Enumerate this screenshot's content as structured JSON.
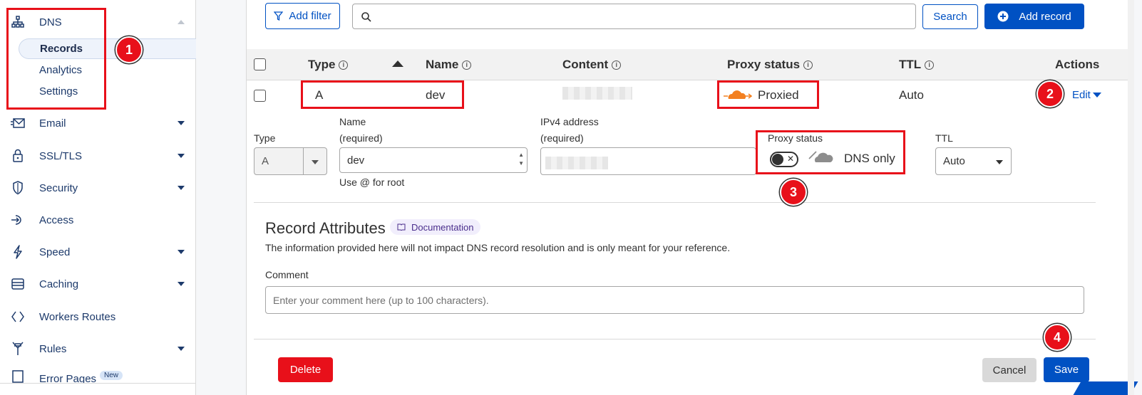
{
  "sidebar": {
    "dns": {
      "label": "DNS",
      "icon": "sitemap-icon"
    },
    "dns_sub": [
      {
        "label": "Records",
        "active": true
      },
      {
        "label": "Analytics",
        "active": false
      },
      {
        "label": "Settings",
        "active": false
      }
    ],
    "items": [
      {
        "label": "Email",
        "icon": "email-icon",
        "has_caret": true
      },
      {
        "label": "SSL/TLS",
        "icon": "lock-icon",
        "has_caret": true
      },
      {
        "label": "Security",
        "icon": "shield-icon",
        "has_caret": true
      },
      {
        "label": "Access",
        "icon": "access-icon",
        "has_caret": false
      },
      {
        "label": "Speed",
        "icon": "bolt-icon",
        "has_caret": true
      },
      {
        "label": "Caching",
        "icon": "database-icon",
        "has_caret": true
      },
      {
        "label": "Workers Routes",
        "icon": "workers-icon",
        "has_caret": false
      },
      {
        "label": "Rules",
        "icon": "rules-icon",
        "has_caret": true
      },
      {
        "label": "Error Pages",
        "icon": "error-pages-icon",
        "badge": "New"
      }
    ]
  },
  "toolbar": {
    "add_filter": "Add filter",
    "search_value": "",
    "search_button": "Search",
    "add_record": "Add record"
  },
  "table": {
    "headers": {
      "type": "Type",
      "name": "Name",
      "content": "Content",
      "proxy_status": "Proxy status",
      "ttl": "TTL",
      "actions": "Actions"
    },
    "row": {
      "type": "A",
      "name": "dev",
      "proxy_status": "Proxied",
      "ttl": "Auto",
      "edit": "Edit"
    }
  },
  "edit_form": {
    "type_label": "Type",
    "type_value": "A",
    "name_label_1": "Name",
    "name_label_2": "(required)",
    "name_value": "dev",
    "name_help": "Use @ for root",
    "ipv4_label_1": "IPv4 address",
    "ipv4_label_2": "(required)",
    "proxy_label": "Proxy status",
    "proxy_state": "DNS only",
    "ttl_label": "TTL",
    "ttl_value": "Auto"
  },
  "attributes": {
    "title": "Record Attributes",
    "doc_link": "Documentation",
    "description": "The information provided here will not impact DNS record resolution and is only meant for your reference.",
    "comment_label": "Comment",
    "comment_placeholder": "Enter your comment here (up to 100 characters)."
  },
  "footer": {
    "delete": "Delete",
    "cancel": "Cancel",
    "save": "Save"
  },
  "annotations": [
    "1",
    "2",
    "3",
    "4"
  ],
  "colors": {
    "accent": "#0051c3",
    "annotation_red": "#e8101a",
    "cloud_orange": "#f38020",
    "delete_red": "#e8101a"
  }
}
